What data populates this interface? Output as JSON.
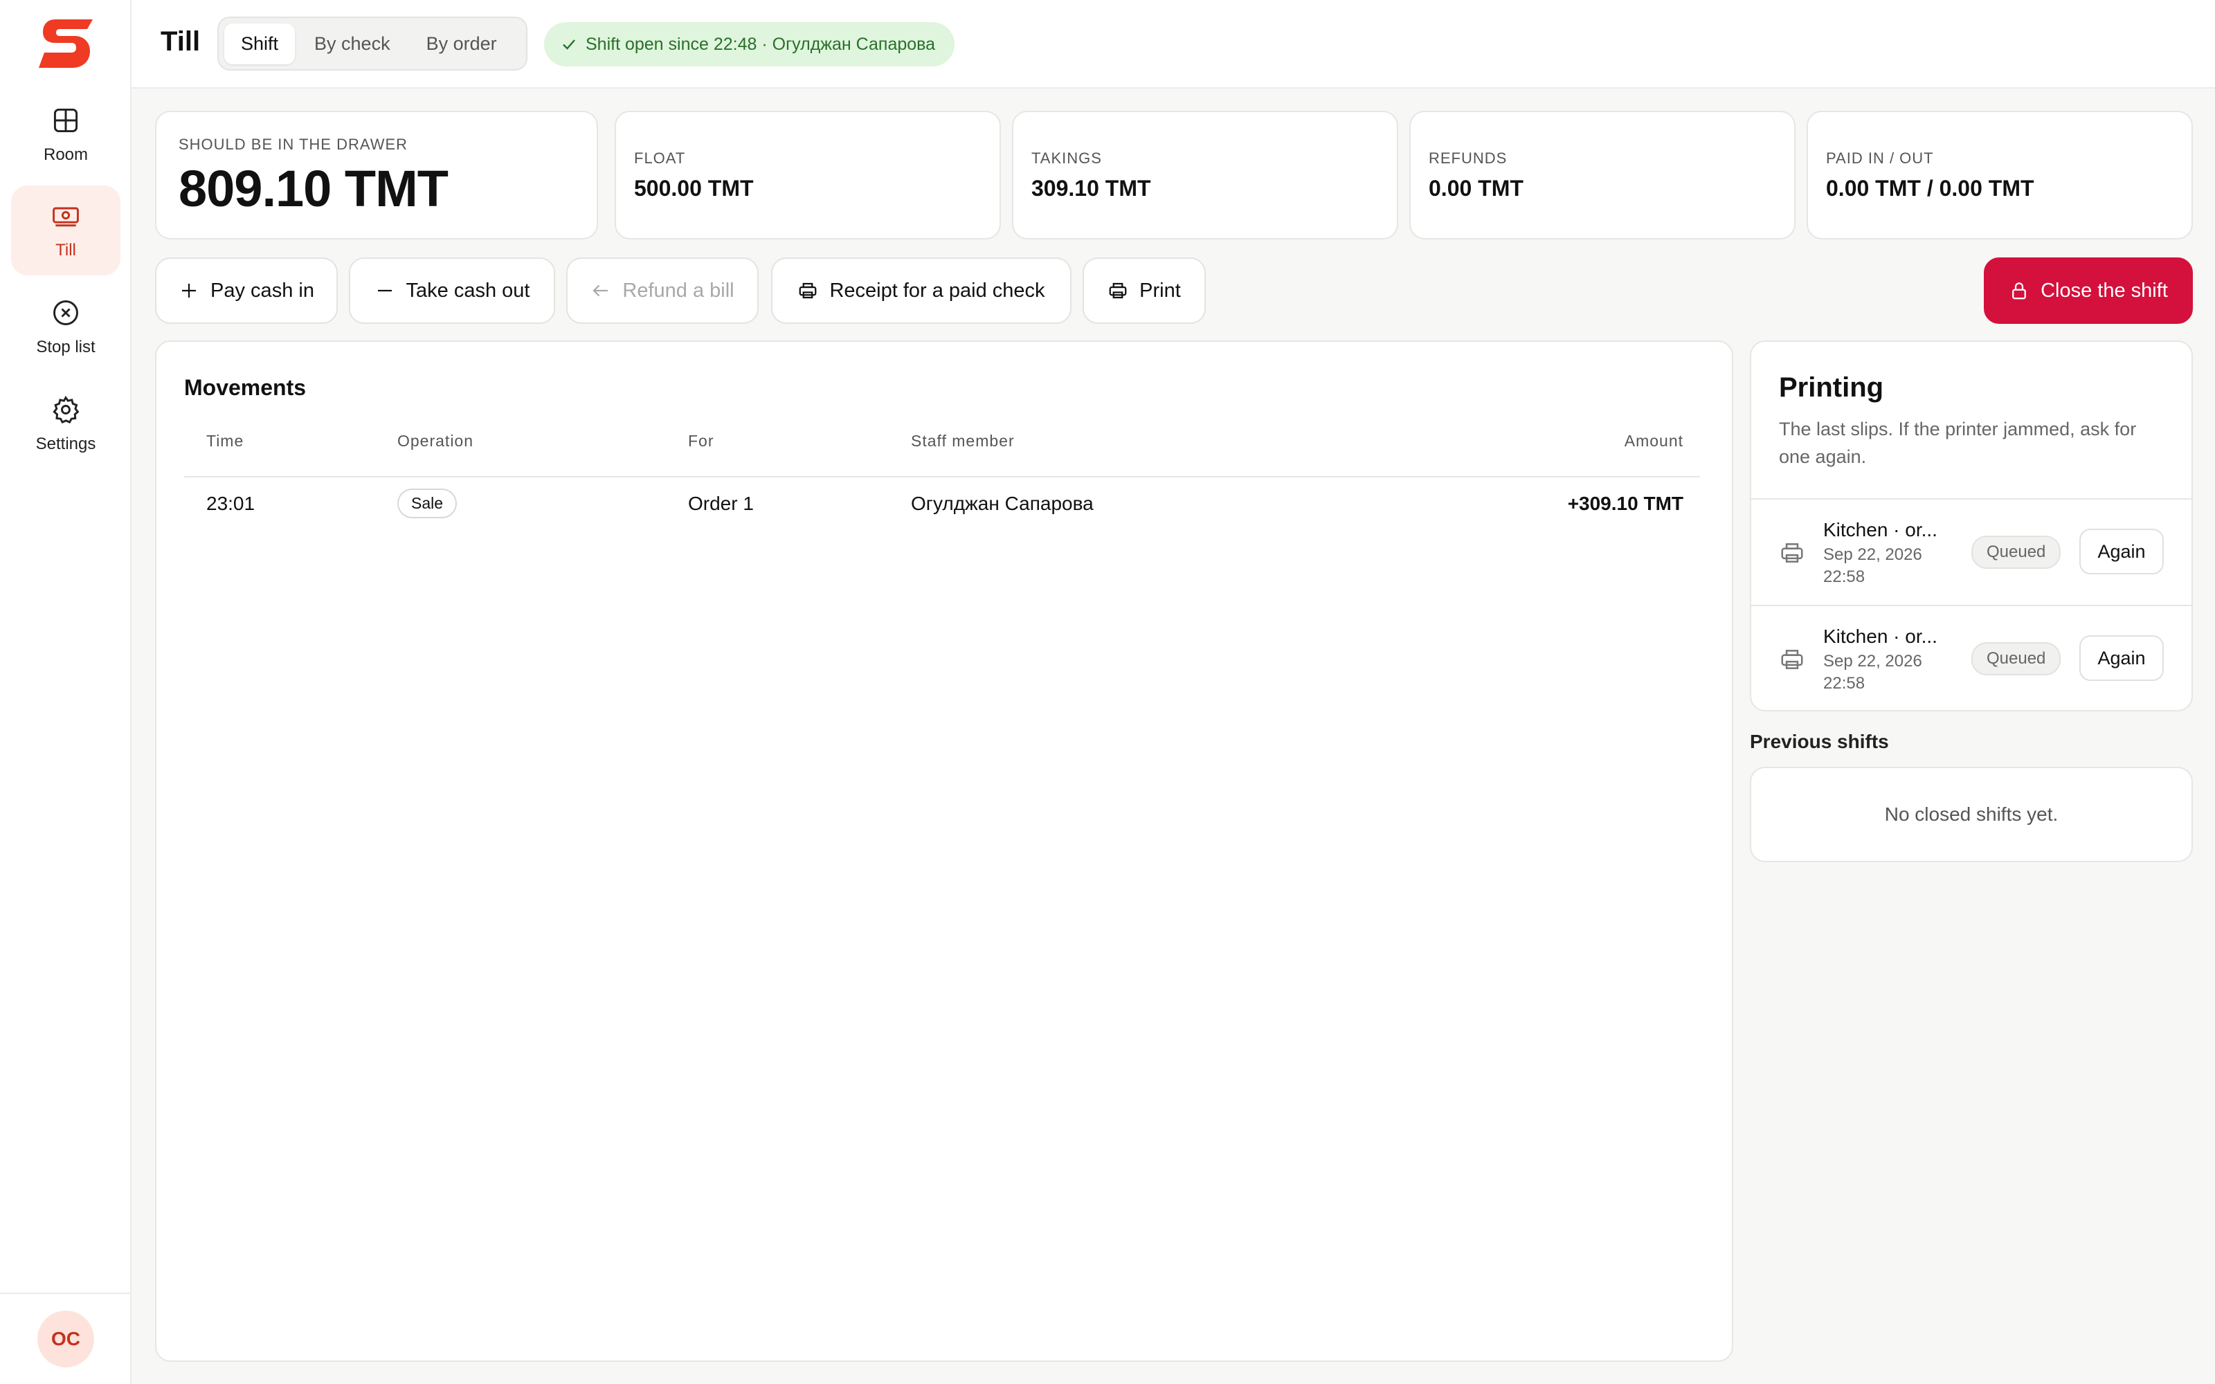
{
  "sidebar": {
    "logo_icon": "s-logo-icon",
    "items": [
      {
        "label": "Room",
        "icon": "grid-icon"
      },
      {
        "label": "Till",
        "icon": "cash-register-icon",
        "active": true
      },
      {
        "label": "Stop list",
        "icon": "x-circle-icon"
      },
      {
        "label": "Settings",
        "icon": "gear-icon"
      }
    ],
    "avatar": "OC"
  },
  "header": {
    "title": "Till",
    "tabs": [
      {
        "label": "Shift",
        "active": true
      },
      {
        "label": "By check"
      },
      {
        "label": "By order"
      }
    ],
    "shift_status": "Shift open since 22:48 · Огулджан Сапарова"
  },
  "stats": {
    "drawer": {
      "label": "Should be in the drawer",
      "value": "809.10 TMT"
    },
    "float": {
      "label": "Float",
      "value": "500.00 TMT"
    },
    "takings": {
      "label": "Takings",
      "value": "309.10 TMT"
    },
    "refunds": {
      "label": "Refunds",
      "value": "0.00 TMT"
    },
    "paid": {
      "label": "Paid in / out",
      "value": "0.00 TMT / 0.00 TMT"
    }
  },
  "actions": {
    "pay_in": "Pay cash in",
    "take_out": "Take cash out",
    "refund": "Refund a bill",
    "receipt": "Receipt for a paid check",
    "print": "Print",
    "close_shift": "Close the shift"
  },
  "movements": {
    "title": "Movements",
    "columns": [
      "Time",
      "Operation",
      "For",
      "Staff member",
      "Amount"
    ],
    "rows": [
      {
        "time": "23:01",
        "operation": "Sale",
        "for": "Order 1",
        "staff": "Огулджан Сапарова",
        "amount": "+309.10 TMT"
      }
    ]
  },
  "printing": {
    "title": "Printing",
    "description": "The last slips. If the printer jammed, ask for one again.",
    "slips": [
      {
        "name": "Kitchen · or...",
        "date": "Sep 22, 2026 22:58",
        "status": "Queued",
        "action": "Again"
      },
      {
        "name": "Kitchen · or...",
        "date": "Sep 22, 2026 22:58",
        "status": "Queued",
        "action": "Again"
      }
    ]
  },
  "previous_shifts": {
    "title": "Previous shifts",
    "empty": "No closed shifts yet."
  },
  "colors": {
    "accent": "#c4321f",
    "danger": "#d4103c",
    "success_bg": "#dff5dd",
    "success_text": "#2a6f2a"
  }
}
